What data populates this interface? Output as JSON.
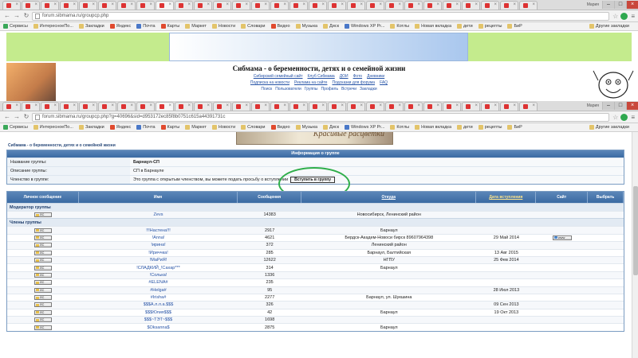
{
  "browser1": {
    "url": "forum.sibmama.ru/groupcp.php",
    "user_label": "Мария",
    "bookmarks": [
      "Сервисы",
      "ИнтересноеПо...",
      "Закладки",
      "Яндекс",
      "Почта",
      "Карты",
      "Маркет",
      "Новости",
      "Словари",
      "Видео",
      "Музыка",
      "Диск",
      "Windows XP Pr...",
      "Котлы",
      "Новая вкладка",
      "дети",
      "рецепты",
      "БиР"
    ],
    "other_bookmarks": "Другие закладки"
  },
  "site": {
    "title": "Сибмама - о беременности, детях и о семейной жизни",
    "links_row1": [
      "Сибирский семейный сайт",
      "Клуб Сибмама",
      "ДОИ",
      "Фото",
      "Дневники"
    ],
    "links_row2": [
      "Подписка на новости",
      "Реклама на сайте",
      "Подсказки для форума",
      "FAQ"
    ],
    "links_row3": [
      "Поиск",
      "Пользователи",
      "Группы",
      "Профиль",
      "Встречи",
      "Закладки"
    ]
  },
  "browser2": {
    "url": "forum.sibmama.ru/groupcp.php?g=40696&sid=d953172ec85f8b0751c615a44391731c",
    "user_label": "Мария",
    "bookmarks": [
      "Сервисы",
      "ИнтересноеПо...",
      "Закладки",
      "Яндекс",
      "Почта",
      "Карты",
      "Маркет",
      "Новости",
      "Словари",
      "Видео",
      "Музыка",
      "Диск",
      "Windows XP Pr...",
      "Котлы",
      "Новая вкладка",
      "дети",
      "рецепты",
      "БиР"
    ],
    "other_bookmarks": "Другие закладки"
  },
  "page": {
    "ad_text": "Красивые расцветки",
    "breadcrumb": "Сибмама - о беременности, детях и о семейной жизни",
    "info": {
      "header": "Информация о группе",
      "name_label": "Название группы:",
      "name_value": "Барнаул-СП",
      "desc_label": "Описание группы:",
      "desc_value": "СП в Барнауле",
      "membership_label": "Членство в группе:",
      "membership_value": "Это группа с открытым членством, вы можете подать просьбу о вступлении",
      "join_button": "Вступить в группу"
    },
    "table": {
      "headers": [
        "Личное сообщение",
        "Имя",
        "Сообщения",
        "Откуда",
        "Дата вступления",
        "Сайт",
        "Выбрать"
      ],
      "pm_label": "ЛС",
      "www_label": "www",
      "moderator_section": "Модератор группы",
      "members_section": "Члены группы",
      "moderators": [
        {
          "name": "Zevs",
          "posts": "14383",
          "from": "Новосибирск, Ленинский район",
          "date": "",
          "site": false
        }
      ],
      "members": [
        {
          "name": "!!!Настена!!!",
          "posts": "2917",
          "from": "Барнаул",
          "date": "",
          "site": false
        },
        {
          "name": "!Anna!",
          "posts": "4621",
          "from": "Бердск-Академ-Новоси бирск 89607964398",
          "date": "29 Май 2014",
          "site": true
        },
        {
          "name": "!ирина!",
          "posts": "372",
          "from": "Ленинский район",
          "date": "",
          "site": false
        },
        {
          "name": "!Ириччка!",
          "posts": "285",
          "from": "Барнаул, Балтийская",
          "date": "13 Авг 2015",
          "site": false
        },
        {
          "name": "!МаРиЯ!",
          "posts": "12622",
          "from": "НГПУ",
          "date": "25 Фев 2014",
          "site": false
        },
        {
          "name": "!СЛАДКИЙ_!Сахар***",
          "posts": "314",
          "from": "Барнаул",
          "date": "",
          "site": false
        },
        {
          "name": "!Солька!",
          "posts": "1336",
          "from": "",
          "date": "",
          "site": false
        },
        {
          "name": "#ELENA#",
          "posts": "235",
          "from": "",
          "date": "",
          "site": false
        },
        {
          "name": "#Helga#",
          "posts": "95",
          "from": "",
          "date": "28 Июл 2013",
          "site": false
        },
        {
          "name": "#Irisha#",
          "posts": "2277",
          "from": "Барнаул, ул. Шукшина",
          "date": "",
          "site": false
        },
        {
          "name": "$$$А.л.л.а.$$$",
          "posts": "326",
          "from": "",
          "date": "09 Сен 2013",
          "site": false
        },
        {
          "name": "$$$Юлия$$$",
          "posts": "42",
          "from": "Барнаул",
          "date": "19 Окт 2013",
          "site": false
        },
        {
          "name": "$$$~ТЭТ~$$$",
          "posts": "1698",
          "from": "",
          "date": "",
          "site": false
        },
        {
          "name": "$Oksanna$",
          "posts": "2875",
          "from": "Барнаул",
          "date": "",
          "site": false
        }
      ]
    }
  }
}
